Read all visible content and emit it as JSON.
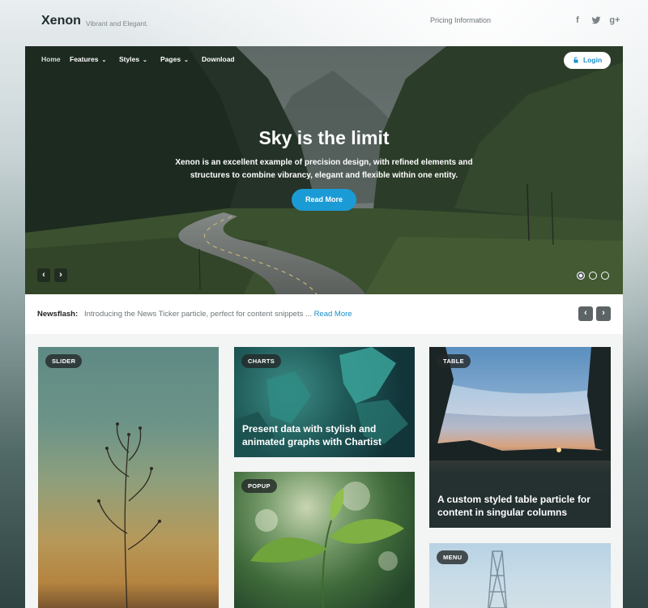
{
  "header": {
    "brand": "Xenon",
    "tagline": "Vibrant and Elegant.",
    "top_link": "Pricing Information",
    "social_icons": [
      "facebook-icon",
      "twitter-icon",
      "google-plus-icon"
    ],
    "social_glyphs": {
      "facebook": "f",
      "twitter": "t",
      "google": "g+"
    }
  },
  "nav": {
    "items": [
      {
        "label": "Home",
        "has_dropdown": false
      },
      {
        "label": "Features",
        "has_dropdown": true
      },
      {
        "label": "Styles",
        "has_dropdown": true
      },
      {
        "label": "Pages",
        "has_dropdown": true
      },
      {
        "label": "Download",
        "has_dropdown": false
      }
    ],
    "caret": "⌄",
    "login_label": "Login"
  },
  "hero": {
    "title": "Sky is the limit",
    "description": "Xenon is an excellent example of precision design, with refined elements and structures to combine vibrancy, elegant and flexible within one entity.",
    "button_label": "Read More",
    "prev_glyph": "‹",
    "next_glyph": "›",
    "slide_count": 3,
    "active_slide": 1
  },
  "newsflash": {
    "label": "Newsflash:",
    "text": "Introducing the News Ticker particle, perfect for content snippets ...",
    "link_label": "Read More",
    "prev_glyph": "‹",
    "next_glyph": "›"
  },
  "cards": {
    "slider": {
      "badge": "SLIDER",
      "title": ""
    },
    "charts": {
      "badge": "CHARTS",
      "title": "Present data with stylish and animated graphs with Chartist"
    },
    "table": {
      "badge": "TABLE",
      "title": "A custom styled table particle for content in singular columns"
    },
    "popup": {
      "badge": "POPUP",
      "title": ""
    },
    "menu": {
      "badge": "MENU",
      "title": ""
    }
  },
  "colors": {
    "accent": "#1b9bd6",
    "link": "#1a8fc9",
    "dark_badge": "#23282880"
  }
}
